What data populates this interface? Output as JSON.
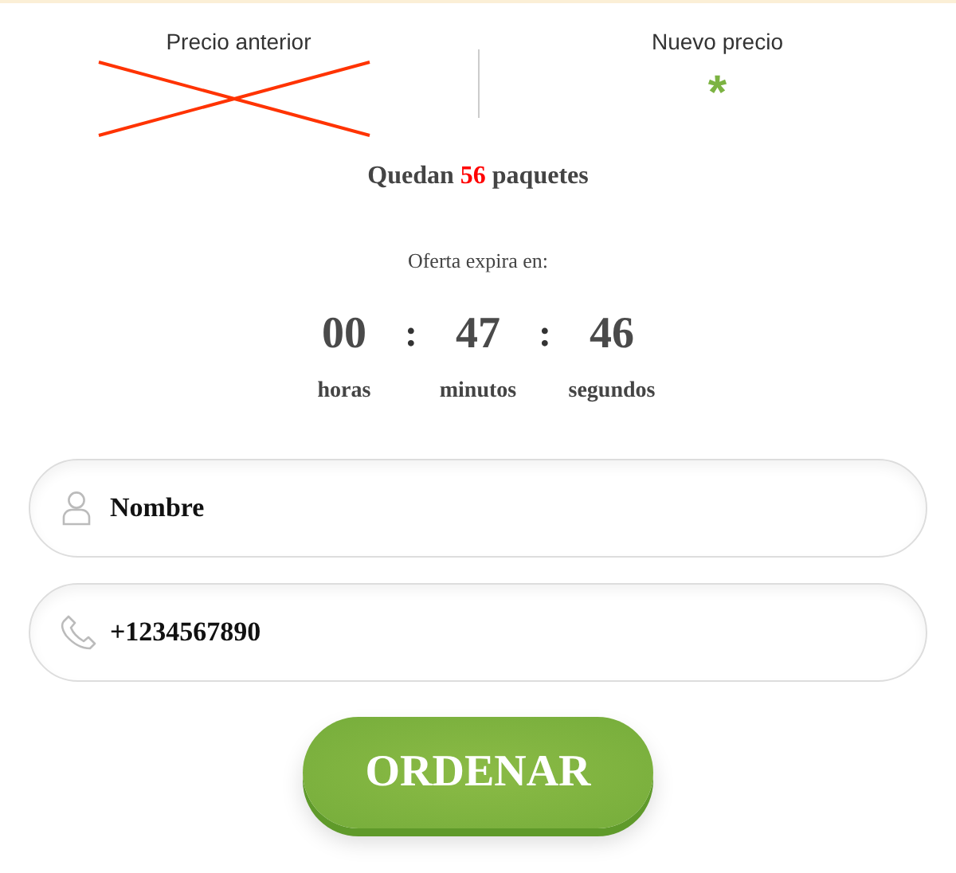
{
  "prices": {
    "old_label": "Precio anterior",
    "new_label": "Nuevo precio",
    "new_value": "*"
  },
  "stock": {
    "prefix": "Quedan",
    "count": "56",
    "suffix": "paquetes"
  },
  "offer": {
    "label": "Oferta expira en:",
    "separator": ":",
    "units": [
      {
        "value": "00",
        "label": "horas"
      },
      {
        "value": "47",
        "label": "minutos"
      },
      {
        "value": "46",
        "label": "segundos"
      }
    ]
  },
  "form": {
    "fields": [
      {
        "kind": "name",
        "placeholder": "Nombre"
      },
      {
        "kind": "phone",
        "placeholder": "+1234567890"
      }
    ],
    "submit": "ORDENAR"
  }
}
